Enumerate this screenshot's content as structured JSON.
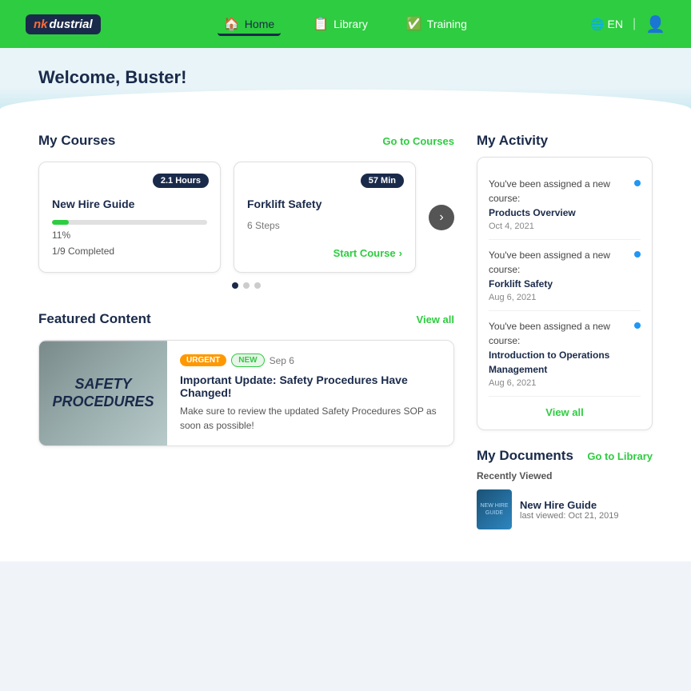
{
  "nav": {
    "logo_text": "nk dustrial",
    "links": [
      {
        "label": "Home",
        "icon": "🏠",
        "active": true
      },
      {
        "label": "Library",
        "icon": "📋",
        "active": false
      },
      {
        "label": "Training",
        "icon": "✅",
        "active": false
      }
    ],
    "language": "EN",
    "lang_icon": "🌐"
  },
  "hero": {
    "welcome": "Welcome, Buster!"
  },
  "courses": {
    "title": "My Courses",
    "link": "Go to Courses",
    "cards": [
      {
        "badge": "2.1 Hours",
        "title": "New Hire Guide",
        "progress": 11,
        "completed": "1/9 Completed"
      },
      {
        "badge": "57 Min",
        "title": "Forklift Safety",
        "steps": "6 Steps",
        "start": "Start Course"
      }
    ],
    "dots": [
      "active",
      "inactive",
      "inactive"
    ]
  },
  "featured": {
    "title": "Featured Content",
    "link": "View all",
    "card": {
      "tag_urgent": "URGENT",
      "tag_new": "NEW",
      "date": "Sep 6",
      "title": "Important Update: Safety Procedures Have Changed!",
      "desc": "Make sure to review the updated Safety Procedures SOP as soon as possible!",
      "image_lines": [
        "SAFETY",
        "PROCEDURES"
      ]
    }
  },
  "activity": {
    "title": "My Activity",
    "items": [
      {
        "text": "You've been assigned a new course:",
        "name": "Products Overview",
        "date": "Oct 4, 2021"
      },
      {
        "text": "You've been assigned a new course:",
        "name": "Forklift Safety",
        "date": "Aug 6, 2021"
      },
      {
        "text": "You've been assigned a new course:",
        "name": "Introduction to Operations Management",
        "date": "Aug 6, 2021"
      }
    ],
    "view_all": "View all"
  },
  "documents": {
    "title": "My Documents",
    "link": "Go to Library",
    "recently_label": "Recently Viewed",
    "items": [
      {
        "name": "New Hire Guide",
        "last_viewed": "last viewed: Oct 21, 2019"
      }
    ]
  }
}
